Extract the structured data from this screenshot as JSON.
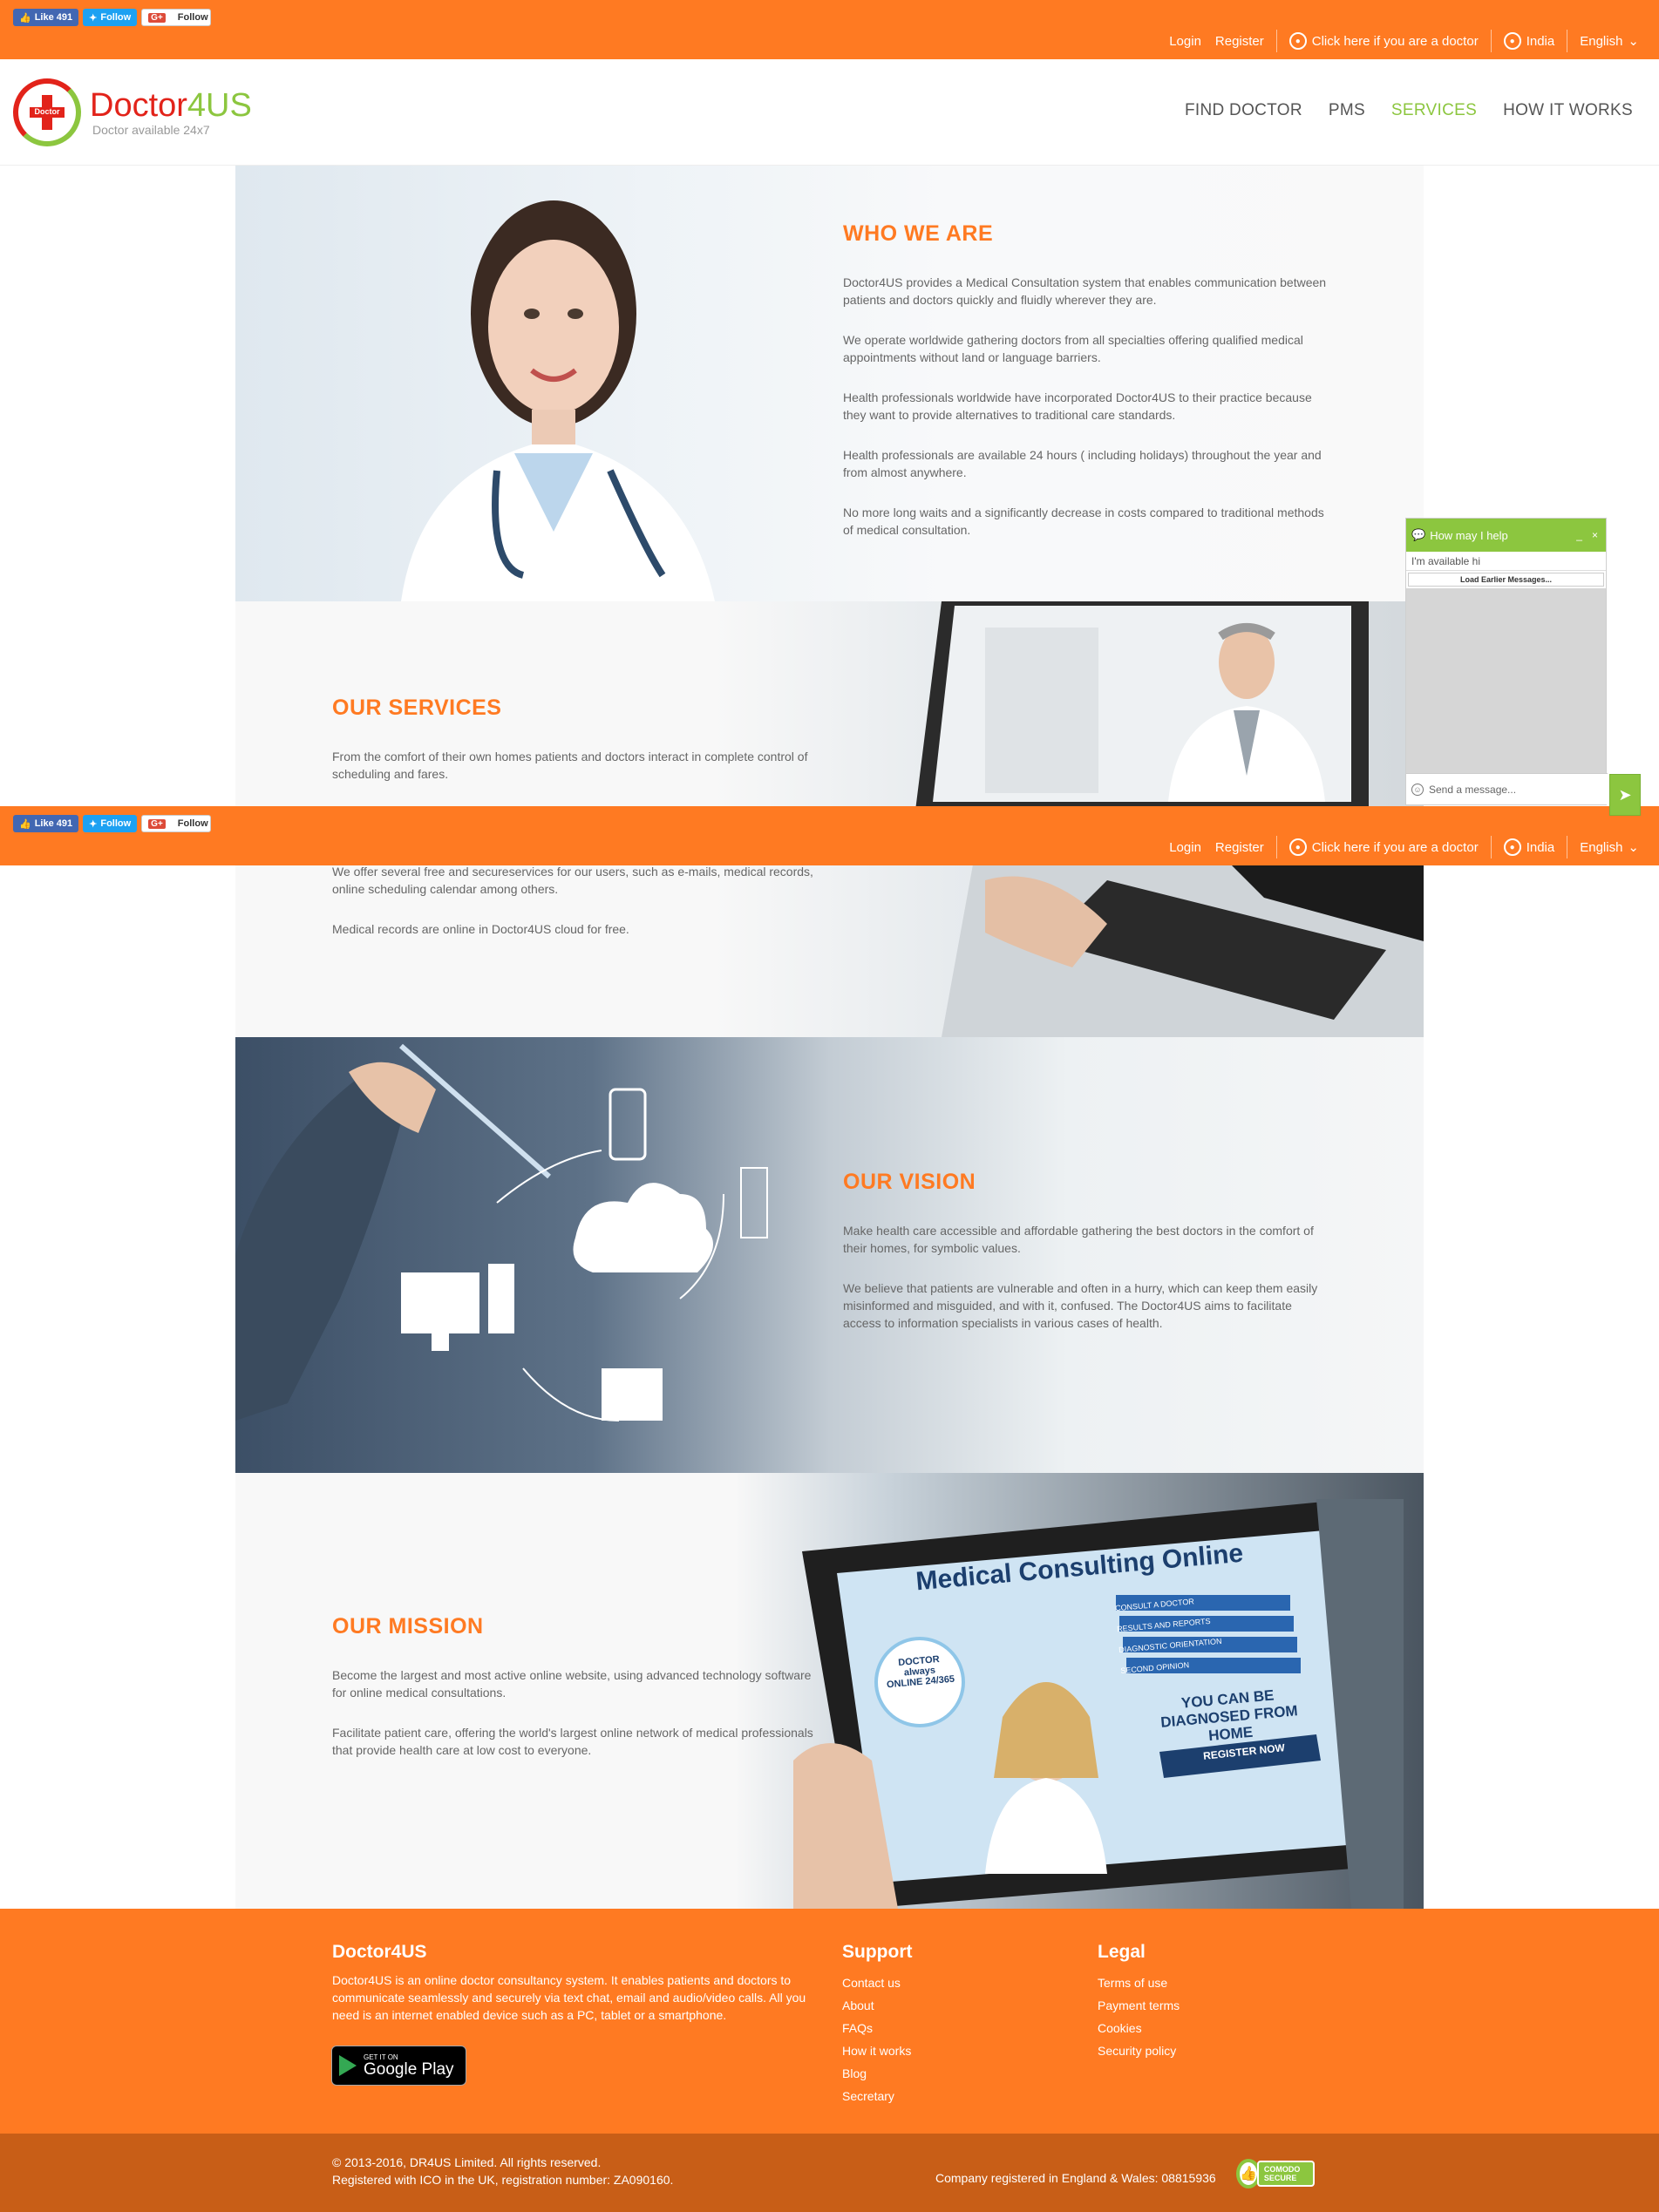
{
  "social": {
    "like_label": "Like 491",
    "twitter_label": "Follow",
    "gplus_label": "Follow"
  },
  "toplinks": {
    "login": "Login",
    "register": "Register",
    "doctor": "Click here if you are a doctor",
    "country": "India",
    "language": "English"
  },
  "logo": {
    "name_part1": "Doctor",
    "name_part2": "4US",
    "tagline": "Doctor available 24x7",
    "mark_text": "Doctor"
  },
  "nav": {
    "find_doctor": "FIND DOCTOR",
    "pms": "PMS",
    "services": "SERVICES",
    "how_it_works": "HOW IT WORKS"
  },
  "who": {
    "title": "WHO WE ARE",
    "p1": "Doctor4US provides a Medical Consultation system that enables communication between patients and doctors quickly and fluidly wherever they are.",
    "p2": "We operate worldwide gathering doctors from all specialties offering qualified medical appointments without land or language barriers.",
    "p3": "Health professionals worldwide have incorporated Doctor4US to their practice because they want to provide alternatives to traditional care standards.",
    "p4": "Health professionals are available 24 hours ( including holidays) throughout the year and from almost anywhere.",
    "p5": "No more long waits and a significantly decrease in costs compared to traditional methods of medical consultation."
  },
  "services": {
    "title": "OUR SERVICES",
    "p1": "From the comfort of their own homes patients and doctors interact in complete control of scheduling and fares.",
    "p2": "We offer several free and secureservices for our users, such as e-mails, medical records, online scheduling calendar among others.",
    "p3": "Medical records are online in Doctor4US cloud for free."
  },
  "vision": {
    "title": "OUR VISION",
    "p1": "Make health care accessible and affordable gathering the best doctors in the comfort of their homes, for symbolic values.",
    "p2": "We believe that patients are vulnerable and often in a hurry, which can keep them easily misinformed and misguided, and with it, confused. The Doctor4US aims to facilitate access to information specialists in various cases of health."
  },
  "mission": {
    "title": "OUR MISSION",
    "p1": "Become the largest and most active online website, using advanced technology software for online medical consultations.",
    "p2": "Facilitate patient care, offering the world's largest online network of medical professionals that provide health care at low cost to everyone.",
    "tablet_heading": "Medical Consulting Online",
    "tablet_badge": "DOCTOR always ONLINE 24/365",
    "tablet_home": "YOU CAN BE DIAGNOSED FROM HOME",
    "tablet_register": "REGISTER NOW",
    "tablet_menu": [
      "CONSULT A DOCTOR",
      "RESULTS AND REPORTS",
      "DIAGNOSTIC ORIENTATION",
      "SECOND OPINION"
    ]
  },
  "chat": {
    "title": "How may I help",
    "minimize": "_",
    "close": "×",
    "status": "I'm available hi",
    "load_earlier": "Load Earlier Messages...",
    "input_placeholder": "Send a message..."
  },
  "footer": {
    "about_title": "Doctor4US",
    "about_text": "Doctor4US is an online doctor consultancy system. It enables patients and doctors to communicate seamlessly and securely via text chat, email and audio/video calls. All you need is an internet enabled device such as a PC, tablet or a smartphone.",
    "gplay_small": "GET IT ON",
    "gplay_big": "Google Play",
    "support_title": "Support",
    "support_links": [
      "Contact us",
      "About",
      "FAQs",
      "How it works",
      "Blog",
      "Secretary"
    ],
    "legal_title": "Legal",
    "legal_links": [
      "Terms of use",
      "Payment terms",
      "Cookies",
      "Security policy"
    ]
  },
  "subfooter": {
    "copyright": "© 2013-2016, DR4US Limited. All rights reserved.",
    "ico": "Registered with ICO in the UK, registration number: ZA090160.",
    "company": "Company registered in England & Wales: 08815936",
    "comodo": "COMODO SECURE"
  },
  "colors": {
    "brand_orange": "#ff7a22",
    "brand_green": "#8cc63f",
    "brand_red": "#e2231a",
    "footer_dark": "#c85e17"
  }
}
